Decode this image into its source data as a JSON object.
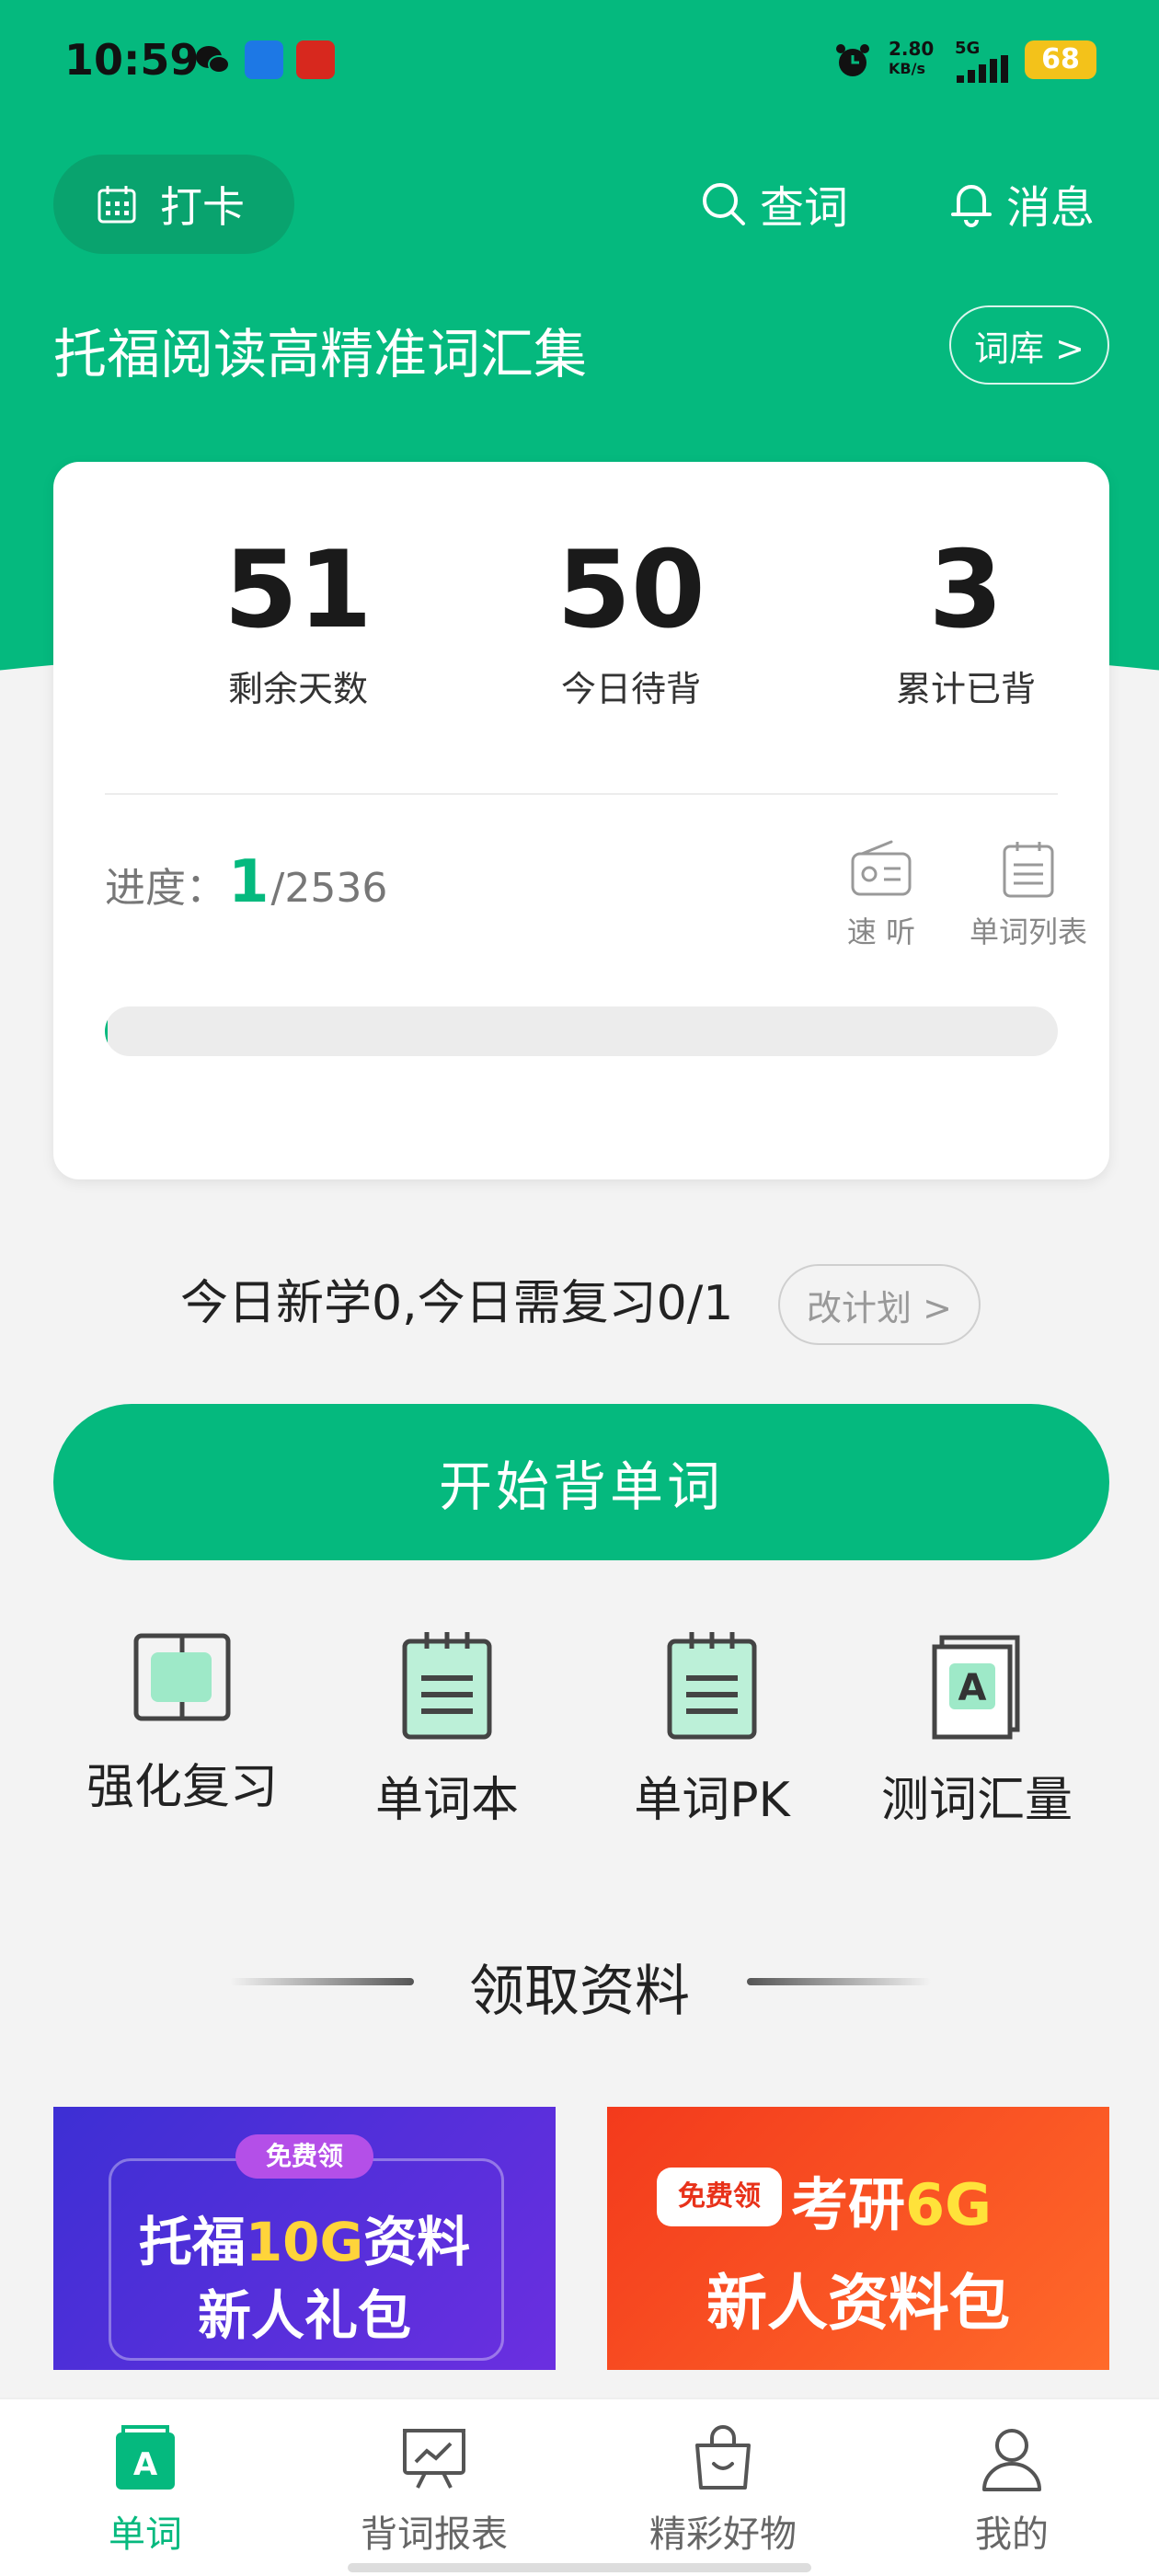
{
  "status_bar": {
    "time": "10:59",
    "network_speed_value": "2.80",
    "network_speed_unit": "KB/s",
    "network_type": "5G",
    "battery": "68"
  },
  "header": {
    "checkin_label": "打卡",
    "lookup_label": "查词",
    "messages_label": "消息",
    "book_title": "托福阅读高精准词汇集",
    "library_label": "词库 >"
  },
  "stats": [
    {
      "value": "51",
      "label": "剩余天数"
    },
    {
      "value": "50",
      "label": "今日待背"
    },
    {
      "value": "3",
      "label": "累计已背"
    }
  ],
  "progress": {
    "label": "进度：",
    "current": "1",
    "total": "/2536",
    "fraction": 0.0004
  },
  "tools": {
    "listen_label": "速 听",
    "word_list_label": "单词列表"
  },
  "plan": {
    "summary": "今日新学0,今日需复习0/1",
    "change_label": "改计划 >"
  },
  "start_button_label": "开始背单词",
  "features": [
    {
      "label": "强化复习",
      "icon": "review-icon"
    },
    {
      "label": "单词本",
      "icon": "notebook-icon"
    },
    {
      "label": "单词PK",
      "icon": "pk-icon"
    },
    {
      "label": "测词汇量",
      "icon": "vocab-test-icon"
    }
  ],
  "section_title": "领取资料",
  "banners": {
    "left": {
      "tag": "免费领",
      "line1_prefix": "托福",
      "line1_highlight": "10G",
      "line1_suffix": "资料",
      "line2": "新人礼包"
    },
    "right": {
      "tag": "免费领",
      "line1_prefix": "考研",
      "line1_highlight": "6G",
      "line2": "新人资料包"
    }
  },
  "bottom_nav": [
    {
      "label": "单词",
      "active": true
    },
    {
      "label": "背词报表",
      "active": false
    },
    {
      "label": "精彩好物",
      "active": false
    },
    {
      "label": "我的",
      "active": false
    }
  ],
  "colors": {
    "brand_green": "#05b97e",
    "background": "#f3f3f3"
  }
}
